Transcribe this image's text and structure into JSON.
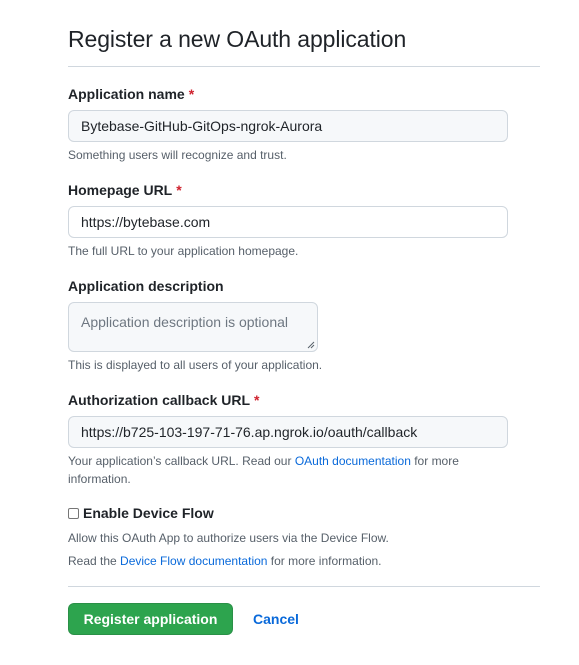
{
  "form": {
    "title": "Register a new OAuth application",
    "required_marker": "*",
    "app_name": {
      "label": "Application name",
      "value": "Bytebase-GitHub-GitOps-ngrok-Aurora",
      "note": "Something users will recognize and trust."
    },
    "homepage": {
      "label": "Homepage URL",
      "value": "https://bytebase.com",
      "note": "The full URL to your application homepage."
    },
    "description": {
      "label": "Application description",
      "placeholder": "Application description is optional",
      "note": "This is displayed to all users of your application."
    },
    "callback": {
      "label": "Authorization callback URL",
      "value": "https://b725-103-197-71-76.ap.ngrok.io/oauth/callback",
      "note_before": "Your application’s callback URL. Read our ",
      "note_link": "OAuth documentation",
      "note_after": " for more information."
    },
    "device_flow": {
      "label": "Enable Device Flow",
      "checked": false,
      "note_line1": "Allow this OAuth App to authorize users via the Device Flow.",
      "note_line2_before": "Read the ",
      "note_line2_link": "Device Flow documentation",
      "note_line2_after": " for more information."
    },
    "actions": {
      "submit_label": "Register application",
      "cancel_label": "Cancel"
    }
  },
  "colors": {
    "required": "#cf222e",
    "link": "#0969da",
    "primary_button": "#2da44e"
  }
}
